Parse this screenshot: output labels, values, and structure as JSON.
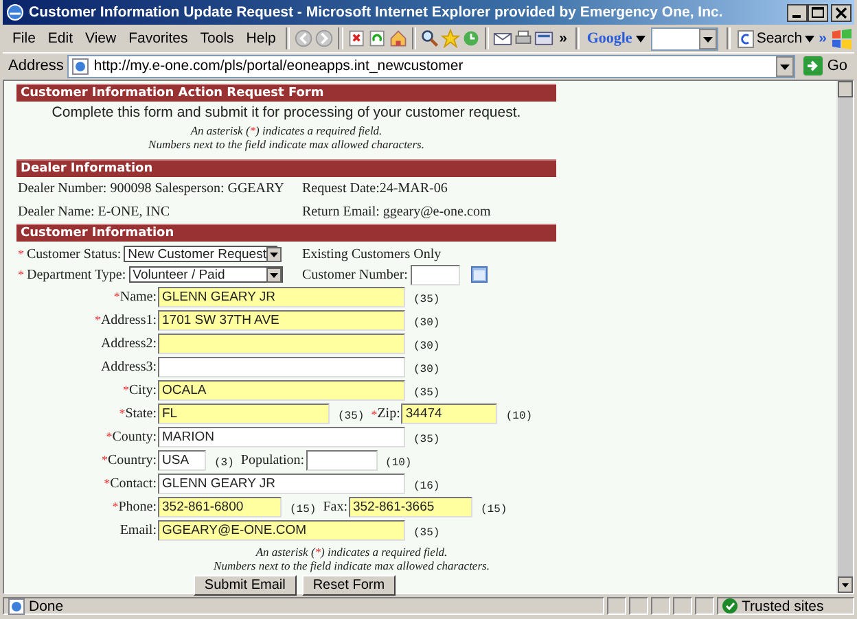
{
  "window": {
    "title": "Customer Information Update Request - Microsoft Internet Explorer provided by Emergency One, Inc."
  },
  "menu": [
    "File",
    "Edit",
    "View",
    "Favorites",
    "Tools",
    "Help"
  ],
  "toolbar": {
    "more": "»",
    "google": "Google",
    "search": "Search",
    "search_more": "»"
  },
  "address_bar": {
    "label": "Address",
    "url": "http://my.e-one.com/pls/portal/eoneapps.int_newcustomer",
    "go": "Go"
  },
  "form": {
    "title": "Customer Information Action Request Form",
    "intro": "Complete this form and submit it for processing of your customer request.",
    "required_mark": "*",
    "notes": [
      {
        "before": "An asterisk (",
        "mark": "*",
        "after": ") indicates a required field."
      },
      {
        "before": "Numbers next to the field indicate max allowed characters."
      }
    ],
    "dealer": {
      "title": "Dealer Information",
      "rows": [
        [
          "Dealer Number: 900098 Salesperson: GGEARY",
          "Request Date:24-MAR-06"
        ],
        [
          "Dealer Name: E-ONE, INC",
          "Return Email: ggeary@e-one.com"
        ]
      ]
    },
    "customer": {
      "title": "Customer Information",
      "status": {
        "label": "Customer Status:",
        "required": true,
        "value": "New Customer Request"
      },
      "existing_note": "Existing Customers Only",
      "department": {
        "label": "Department Type:",
        "required": true,
        "value": "Volunteer / Paid"
      },
      "customer_number": {
        "label": "Customer Number:"
      },
      "fields": [
        {
          "label": "Name:",
          "required": true,
          "value": "GLENN GEARY JR",
          "highlighted": true,
          "kind": "long",
          "max": "(35)"
        },
        {
          "label": "Address1:",
          "required": true,
          "value": "1701 SW 37TH AVE",
          "highlighted": true,
          "kind": "long",
          "max": "(30)"
        },
        {
          "label": "Address2:",
          "required": false,
          "highlighted": true,
          "kind": "long",
          "max": "(30)"
        },
        {
          "label": "Address3:",
          "required": false,
          "highlighted": false,
          "kind": "long",
          "max": "(30)"
        },
        {
          "label": "City:",
          "required": true,
          "value": "OCALA",
          "highlighted": true,
          "kind": "long",
          "max": "(35)"
        },
        {
          "label": "State:",
          "required": true,
          "value": "FL",
          "highlighted": true,
          "kind": "medium",
          "max": "(35)",
          "extra": {
            "label": "Zip:",
            "required": true,
            "value": "34474",
            "highlighted": true,
            "kind": "narrow",
            "max": "(10)"
          }
        },
        {
          "label": "County:",
          "required": true,
          "value": "MARION",
          "highlighted": false,
          "kind": "long",
          "max": "(35)"
        },
        {
          "label": "Country:",
          "required": true,
          "value": "USA",
          "highlighted": false,
          "kind": "tiny",
          "max": "(3)",
          "extra": {
            "label": "Population:",
            "required": false,
            "highlighted": false,
            "kind": "small",
            "max": "(10)"
          }
        },
        {
          "label": "Contact:",
          "required": true,
          "value": "GLENN GEARY JR",
          "highlighted": false,
          "kind": "long",
          "max": "(16)"
        },
        {
          "label": "Phone:",
          "required": true,
          "value": "352-861-6800",
          "highlighted": true,
          "kind": "short",
          "max": "(15)",
          "extra": {
            "label": "Fax:",
            "required": false,
            "value": "352-861-3665",
            "highlighted": true,
            "kind": "short",
            "max": "(15)"
          }
        },
        {
          "label": "Email:",
          "required": false,
          "value": "GGEARY@E-ONE.COM",
          "highlighted": true,
          "kind": "long",
          "max": "(35)"
        }
      ]
    },
    "footer_notes": [
      {
        "before": "An asterisk (",
        "mark": "*",
        "after": ") indicates a required field."
      },
      {
        "before": "Numbers next to the field indicate max allowed characters."
      }
    ],
    "buttons": [
      "Submit Email",
      "Reset Form"
    ]
  },
  "status_bar": {
    "text": "Done",
    "zone": "Trusted sites"
  }
}
